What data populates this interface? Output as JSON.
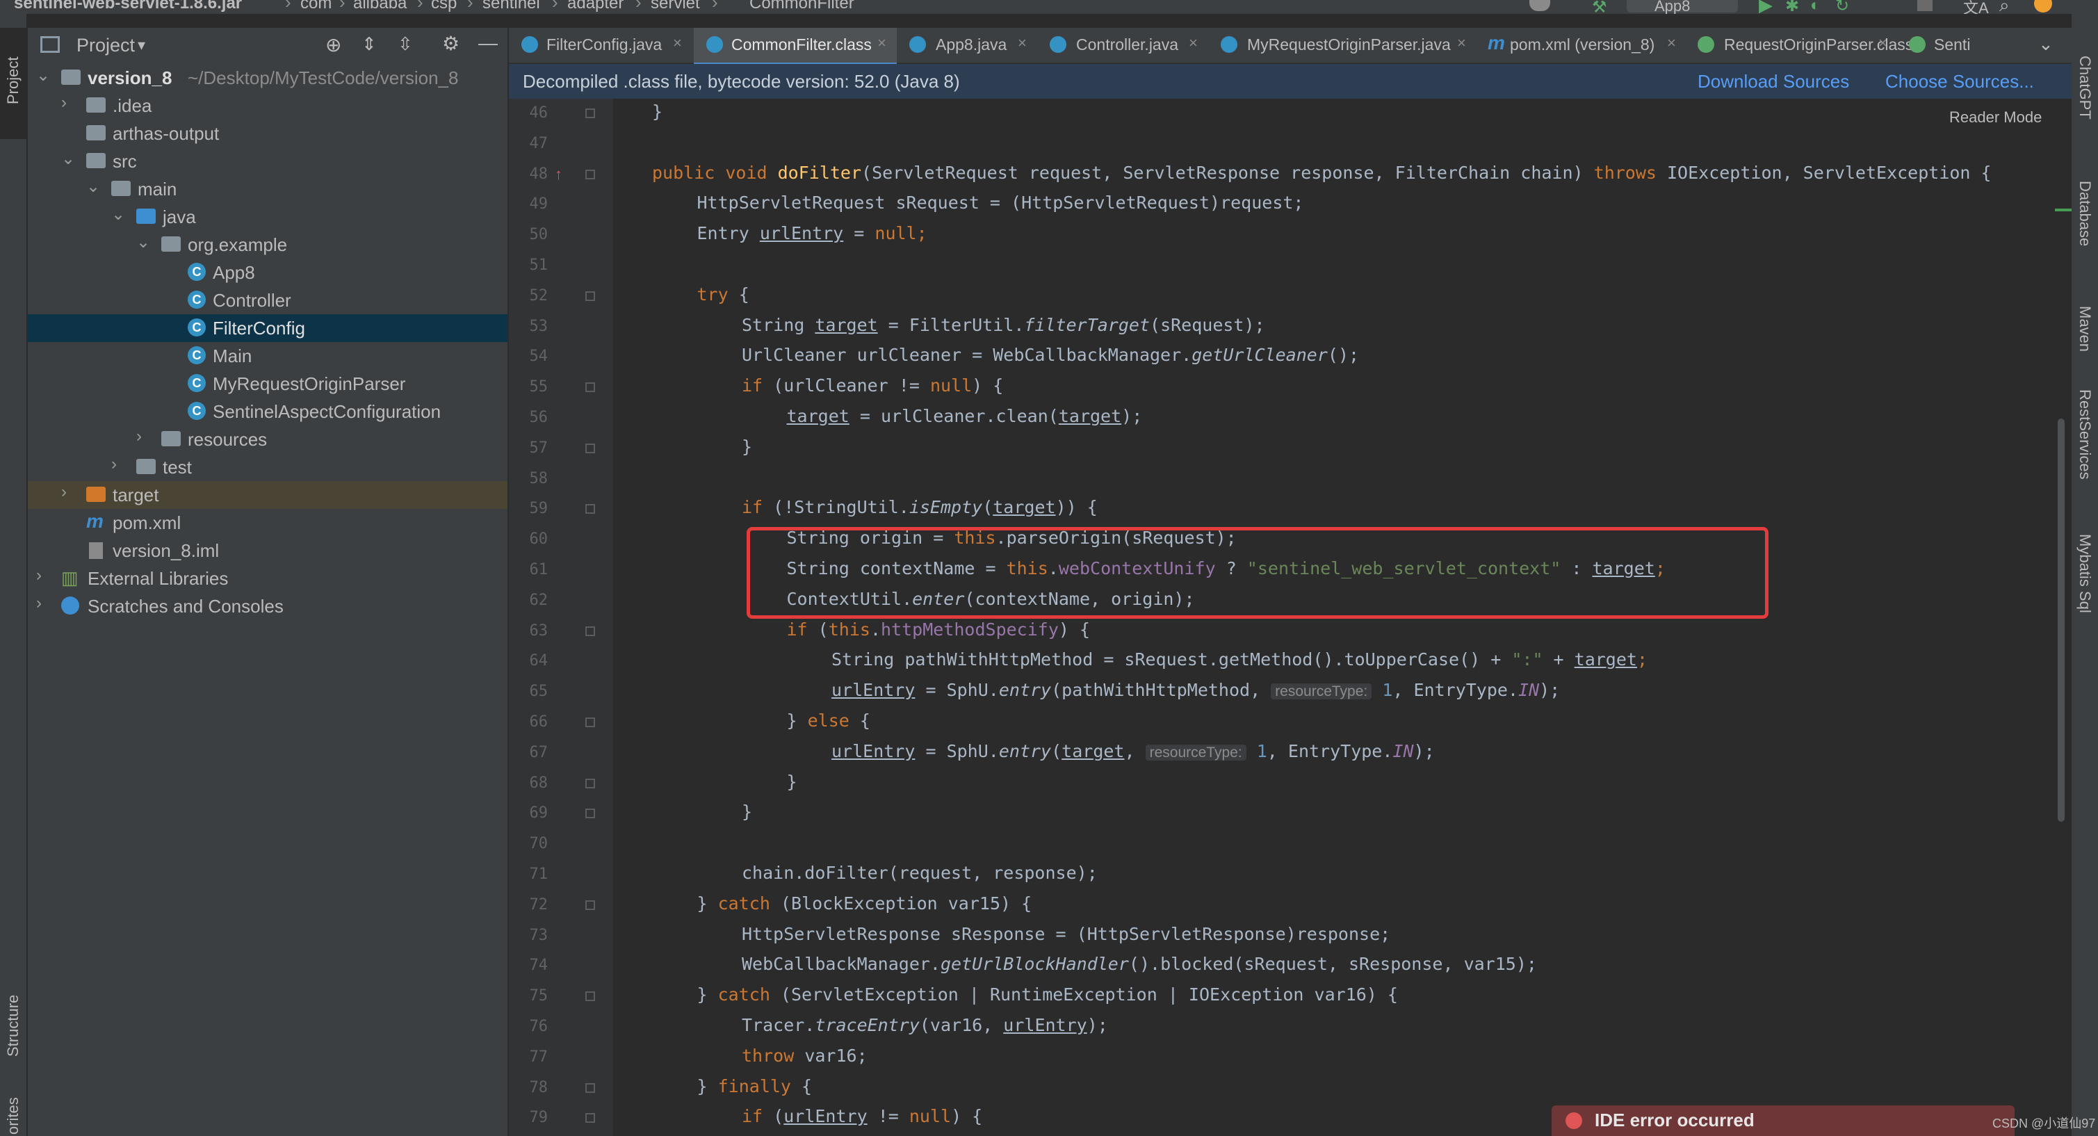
{
  "breadcrumb": [
    "sentinel-web-servlet-1.8.6.jar",
    "com",
    "alibaba",
    "csp",
    "sentinel",
    "adapter",
    "servlet",
    "CommonFilter"
  ],
  "toolbar": {
    "run_config": "App8"
  },
  "side_tools": {
    "left_top": "Project",
    "left_bottom": "Structure",
    "left_bottom2": "orites",
    "right": [
      "ChatGPT",
      "Database",
      "Maven",
      "RestServices",
      "Mybatis Sql"
    ]
  },
  "project": {
    "title": "Project",
    "tree": [
      {
        "label": "version_8",
        "extra": "~/Desktop/MyTestCode/version_8"
      },
      {
        "label": ".idea"
      },
      {
        "label": "arthas-output"
      },
      {
        "label": "src"
      },
      {
        "label": "main"
      },
      {
        "label": "java"
      },
      {
        "label": "org.example"
      },
      {
        "label": "App8"
      },
      {
        "label": "Controller"
      },
      {
        "label": "FilterConfig"
      },
      {
        "label": "Main"
      },
      {
        "label": "MyRequestOriginParser"
      },
      {
        "label": "SentinelAspectConfiguration"
      },
      {
        "label": "resources"
      },
      {
        "label": "test"
      },
      {
        "label": "target"
      },
      {
        "label": "pom.xml"
      },
      {
        "label": "version_8.iml"
      },
      {
        "label": "External Libraries"
      },
      {
        "label": "Scratches and Consoles"
      }
    ]
  },
  "tabs": [
    "FilterConfig.java",
    "CommonFilter.class",
    "App8.java",
    "Controller.java",
    "MyRequestOriginParser.java",
    "pom.xml (version_8)",
    "RequestOriginParser.class",
    "Senti"
  ],
  "banner": {
    "text": "Decompiled .class file, bytecode version: 52.0 (Java 8)",
    "download": "Download Sources",
    "choose": "Choose Sources..."
  },
  "editor": {
    "reader_mode": "Reader Mode",
    "line_numbers": [
      "46",
      "47",
      "48",
      "49",
      "50",
      "51",
      "52",
      "53",
      "54",
      "55",
      "56",
      "57",
      "58",
      "59",
      "60",
      "61",
      "62",
      "63",
      "64",
      "65",
      "66",
      "67",
      "68",
      "69",
      "70",
      "71",
      "72",
      "73",
      "74",
      "75",
      "76",
      "77",
      "78",
      "79"
    ],
    "hint_resource_type": "resourceType:",
    "lines": {
      "l46": "}",
      "l48a": "public void ",
      "l48b": "doFilter",
      "l48c": "(ServletRequest request, ServletResponse response, FilterChain chain) ",
      "l48d": "throws ",
      "l48e": "IOException, ServletException {",
      "l49": "HttpServletRequest sRequest = (HttpServletRequest)request;",
      "l50a": "Entry ",
      "l50b": "urlEntry",
      "l50c": " = ",
      "l50d": "null",
      ";": ";",
      "l52a": "try ",
      "l52b": "{",
      "l53a": "String ",
      "l53b": "target",
      "l53c": " = FilterUtil.",
      "l53d": "filterTarget",
      "l53e": "(sRequest);",
      "l54a": "UrlCleaner urlCleaner = WebCallbackManager.",
      "l54b": "getUrlCleaner",
      "l54c": "();",
      "l55a": "if ",
      "l55b": "(urlCleaner != ",
      "l55c": "null",
      ") {": ") {",
      "l56a": "target",
      "l56b": " = urlCleaner.clean(",
      "l56c": "target",
      "l56d": ");",
      "l57": "}",
      "l59a": "if ",
      "l59b": "(!StringUtil.",
      "l59c": "isEmpty",
      "l59d": "(",
      "l59e": "target",
      "l59f": ")) {",
      "l60a": "String origin = ",
      "l60b": "this",
      ".": ".",
      "l60c": "parseOrigin(sRequest);",
      "l61a": "String contextName = ",
      "l61b": "this",
      "l61c": "webContextUnify",
      " ? ": " ? ",
      "l61d": "\"sentinel_web_servlet_context\"",
      " : ": " : ",
      "l61e": "target",
      "l62a": "ContextUtil.",
      "l62b": "enter",
      "l62c": "(contextName, origin);",
      "l63a": "if ",
      "l63b": "(",
      "l63c": "this",
      "l63d": "httpMethodSpecify",
      ")": ") {",
      "l64a": "String pathWithHttpMethod = sRequest.getMethod().toUpperCase() + ",
      "l64b": "\":\"",
      " + ": " + ",
      "l64c": "target",
      "l65a": "urlEntry",
      "l65b": " = SphU.",
      "l65c": "entry",
      "l65d": "(pathWithHttpMethod, ",
      "one": "1",
      ", EntryType.": ", EntryType.",
      "IN": "IN",
      ");": ");",
      "l66a": "} ",
      "l66b": "else ",
      "l66c": "{",
      "l67c": "(",
      "l71": "chain.doFilter(request, response);",
      "l72a": "} ",
      "l72b": "catch ",
      "l72c": "(BlockException var15) {",
      "l73": "HttpServletResponse sResponse = (HttpServletResponse)response;",
      "l74a": "WebCallbackManager.",
      "l74b": "getUrlBlockHandler",
      "l74c": "().blocked(sRequest, sResponse, var15);",
      "l75a": "} ",
      "l75b": "catch ",
      "l75c": "(ServletException | RuntimeException | IOException var16) {",
      "l76a": "Tracer.",
      "l76b": "traceEntry",
      "l76c": "(var16, ",
      "l76d": "urlEntry",
      "l76e": ");",
      "l77a": "throw ",
      "l77b": "var16;",
      "l78a": "} ",
      "l78b": "finally ",
      "l78c": "{",
      "l79a": "if ",
      "l79b": "(",
      "l79c": "urlEntry",
      "l79d": " != ",
      "l79e": "null",
      "l79f": ") {"
    }
  },
  "toast": "IDE error occurred",
  "watermark": "CSDN @小道仙97",
  "colors": {
    "keyword": "#cc7832",
    "function": "#ffc66d",
    "string": "#6a8759",
    "number": "#6897bb",
    "field": "#9876aa",
    "highlight": "#e33c3c",
    "selection": "#0d3349"
  }
}
